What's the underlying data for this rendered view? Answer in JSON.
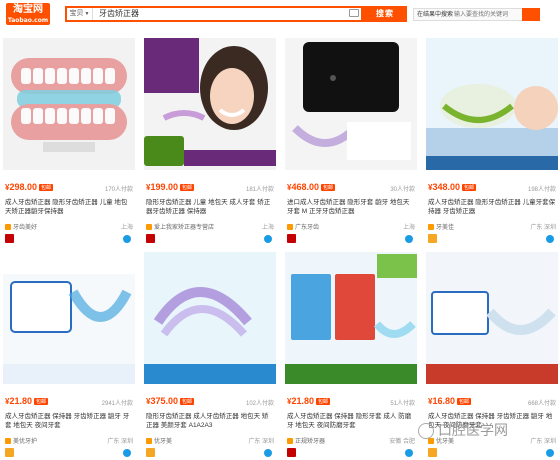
{
  "header": {
    "logo": {
      "l1": "淘宝网",
      "l2": "Taobao.com"
    },
    "search_scope": "宝贝",
    "search_query": "牙齿矫正器",
    "search_button": "搜索",
    "shop_search_label": "在结果中搜索",
    "shop_search_placeholder": "输入要查找的关键词"
  },
  "items": [
    {
      "price": "298.00",
      "tag": "包邮",
      "sold": "170人付款",
      "title": "成人牙齿矫正器 隐形牙齿矫正器 儿童 地包天矫正器龅牙保持器",
      "seller": "牙齿美好",
      "loc": "上海"
    },
    {
      "price": "199.00",
      "tag": "包邮",
      "sold": "181人付款",
      "title": "隐形牙齿矫正器 儿童 地包天 成人牙套 矫正器牙齿矫正器 保持器",
      "seller": "爱上我家矫正器专营店",
      "loc": "上海"
    },
    {
      "price": "468.00",
      "tag": "包邮",
      "sold": "30人付款",
      "title": "进口成人牙齿矫正器 隐形牙套 龅牙 地包天 牙套 M 正牙牙齿矫正器",
      "seller": "广东牙齿",
      "loc": "上海"
    },
    {
      "price": "348.00",
      "tag": "包邮",
      "sold": "198人付款",
      "title": "成人牙齿矫正器 隐形牙齿矫正器 儿童牙套保持器 牙齿矫正器",
      "seller": "牙美佳",
      "loc": "广东 深圳"
    },
    {
      "price": "21.80",
      "tag": "包邮",
      "sold": "2941人付款",
      "title": "成人牙齿矫正器 保持器 牙齿矫正器 龅牙 牙套 地包天 夜间牙套",
      "seller": "美优牙护",
      "loc": "广东 深圳"
    },
    {
      "price": "375.00",
      "tag": "包邮",
      "sold": "102人付款",
      "title": "隐形牙齿矫正器 成人牙齿矫正器 地包天 矫正器 美颜牙套 A1A2A3",
      "seller": "优牙美",
      "loc": "广东 深圳"
    },
    {
      "price": "21.80",
      "tag": "包邮",
      "sold": "51人付款",
      "title": "成人牙齿矫正器 保持器 隐形牙套 成人 防磨牙 地包天 夜间防磨牙套",
      "seller": "正规矫牙器",
      "loc": "安徽 合肥"
    },
    {
      "price": "16.80",
      "tag": "包邮",
      "sold": "668人付款",
      "title": "成人牙齿矫正器 保持器 牙齿矫正器 龅牙 地包天 夜间防磨牙套",
      "seller": "优牙美",
      "loc": "广东 深圳"
    }
  ],
  "watermark": "口腔医学网",
  "colors": {
    "accent": "#ff5000",
    "price": "#ff4400"
  }
}
